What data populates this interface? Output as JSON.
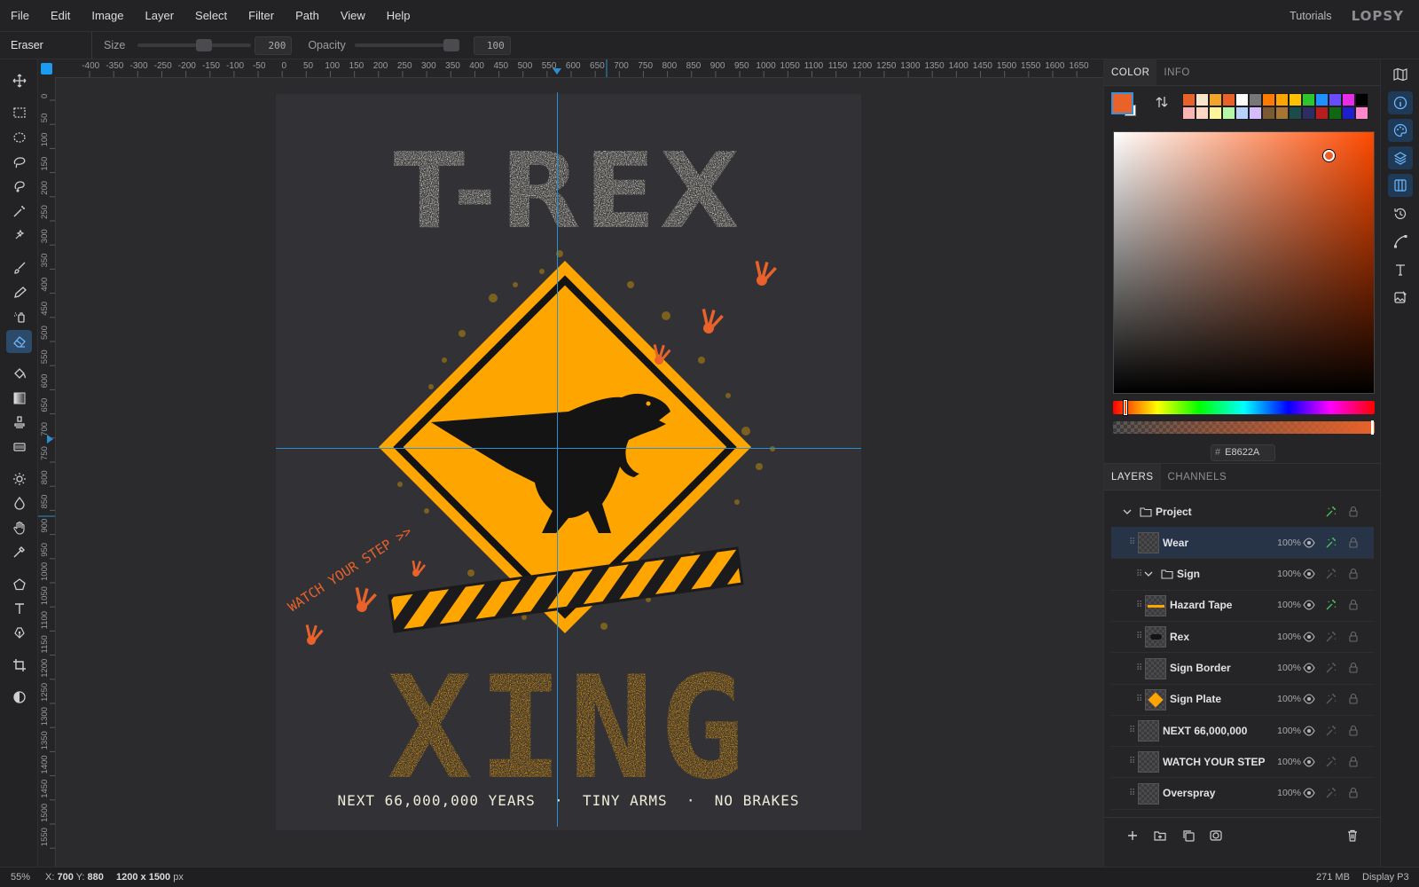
{
  "menubar": {
    "items": [
      "File",
      "Edit",
      "Image",
      "Layer",
      "Select",
      "Filter",
      "Path",
      "View",
      "Help"
    ],
    "tutorials": "Tutorials",
    "logo": "LOPSY"
  },
  "options": {
    "tool_name": "Eraser",
    "size_label": "Size",
    "size_value": "200",
    "size_fraction": 0.6,
    "opacity_label": "Opacity",
    "opacity_value": "100",
    "opacity_fraction": 1.0
  },
  "tools": [
    "move-tool",
    "rect-marquee-tool",
    "ellipse-marquee-tool",
    "lasso-tool",
    "magnetic-lasso-tool",
    "magic-wand-tool",
    "quick-select-tool",
    "brush-tool",
    "pencil-tool",
    "clone-tool",
    "eraser-tool",
    "fill-tool",
    "gradient-tool",
    "stamp-tool",
    "smudge-tool",
    "dodge-tool",
    "burn-tool",
    "hand-tool",
    "eyedropper-tool",
    "polygon-tool",
    "text-tool",
    "pen-tool",
    "crop-tool",
    "contrast-tool"
  ],
  "ruler": {
    "h_labels": [
      "-400",
      "-350",
      "-300",
      "-250",
      "-200",
      "-150",
      "-100",
      "-50",
      "0",
      "50",
      "100",
      "150",
      "200",
      "250",
      "300",
      "350",
      "400",
      "450",
      "500",
      "550",
      "600",
      "650",
      "700",
      "750",
      "800",
      "850",
      "900",
      "950",
      "1000",
      "1050",
      "1100",
      "1150",
      "1200",
      "1250",
      "1300",
      "1350",
      "1400",
      "1450",
      "1500",
      "1550",
      "1600",
      "1650"
    ],
    "v_labels": [
      "0",
      "50",
      "100",
      "150",
      "200",
      "250",
      "300",
      "350",
      "400",
      "450",
      "500",
      "550",
      "600",
      "650",
      "700",
      "750",
      "800",
      "850",
      "900",
      "950",
      "1000",
      "1050",
      "1100",
      "1150",
      "1200",
      "1250",
      "1300",
      "1350",
      "1400",
      "1450",
      "1500",
      "1550"
    ]
  },
  "artwork": {
    "title": "T-REX",
    "subtitle": "XING",
    "tagline": "NEXT 66,000,000 YEARS  ·  TINY ARMS  ·  NO BRAKES",
    "side_text": "WATCH YOUR STEP >>"
  },
  "color_panel": {
    "tabs": [
      "COLOR",
      "INFO"
    ],
    "foreground": "#E8622A",
    "background": "#FFFFFF",
    "hex_prefix": "#",
    "hex": "E8622A",
    "swatches": [
      "#E8622A",
      "#F7E6CC",
      "#F2A32A",
      "#E8622A",
      "#FFFFFF",
      "#777777",
      "#FF7A00",
      "#FFA500",
      "#FFC200",
      "#2DC52D",
      "#1E90FF",
      "#6A4CFF",
      "#E82DE8",
      "#000000",
      "#F9B5B5",
      "#FFD6C2",
      "#FFF59A",
      "#B7F7A8",
      "#B8D2FF",
      "#D5BCFF",
      "#7B5A33",
      "#A67433",
      "#1D4A4A",
      "#2D2D66",
      "#B81D1D",
      "#116611",
      "#1E1ECC",
      "#FF88CC"
    ]
  },
  "layers_panel": {
    "tabs": [
      "LAYERS",
      "CHANNELS"
    ],
    "layers": [
      {
        "name": "Project",
        "opacity": "",
        "type": "group",
        "indent": 0
      },
      {
        "name": "Wear",
        "opacity": "100%",
        "type": "layer",
        "indent": 0
      },
      {
        "name": "Sign",
        "opacity": "100%",
        "type": "group",
        "indent": 1
      },
      {
        "name": "Hazard Tape",
        "opacity": "100%",
        "type": "layer",
        "indent": 1
      },
      {
        "name": "Rex",
        "opacity": "100%",
        "type": "layer",
        "indent": 1
      },
      {
        "name": "Sign Border",
        "opacity": "100%",
        "type": "layer",
        "indent": 1
      },
      {
        "name": "Sign Plate",
        "opacity": "100%",
        "type": "layer",
        "indent": 1
      },
      {
        "name": "NEXT 66,000,000",
        "opacity": "100%",
        "type": "layer",
        "indent": 0
      },
      {
        "name": "WATCH YOUR STEP",
        "opacity": "100%",
        "type": "layer",
        "indent": 0
      },
      {
        "name": "Overspray",
        "opacity": "100%",
        "type": "layer",
        "indent": 0
      }
    ]
  },
  "status": {
    "zoom": "55%",
    "x_label": "X:",
    "x_value": "700",
    "y_label": "Y:",
    "y_value": "880",
    "doc_size": "1200 x 1500",
    "doc_unit": "px",
    "memory": "271 MB",
    "color_profile": "Display P3"
  },
  "colors": {
    "accent": "#1D9BF0",
    "sign_yellow": "#FFA500",
    "rust": "#E8622A",
    "cream": "#F0EAD8",
    "guide": "#2A8FD0"
  }
}
